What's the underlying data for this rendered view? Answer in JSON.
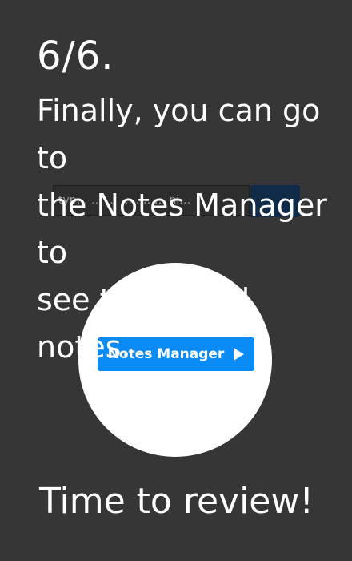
{
  "step": {
    "number": "6/6."
  },
  "description": "Finally, you can go to\nthe Notes Manager to\nsee the saved notes.",
  "background_toolbar": {
    "input_text": "typ… … … ………… ni…"
  },
  "preview": {
    "button_label": "Notes Manager",
    "button_icon": "play-icon",
    "button_color": "#0a8bf5"
  },
  "closing_text": "Time to review!",
  "colors": {
    "background": "#363636",
    "text": "#ffffff",
    "circle": "#ffffff"
  }
}
